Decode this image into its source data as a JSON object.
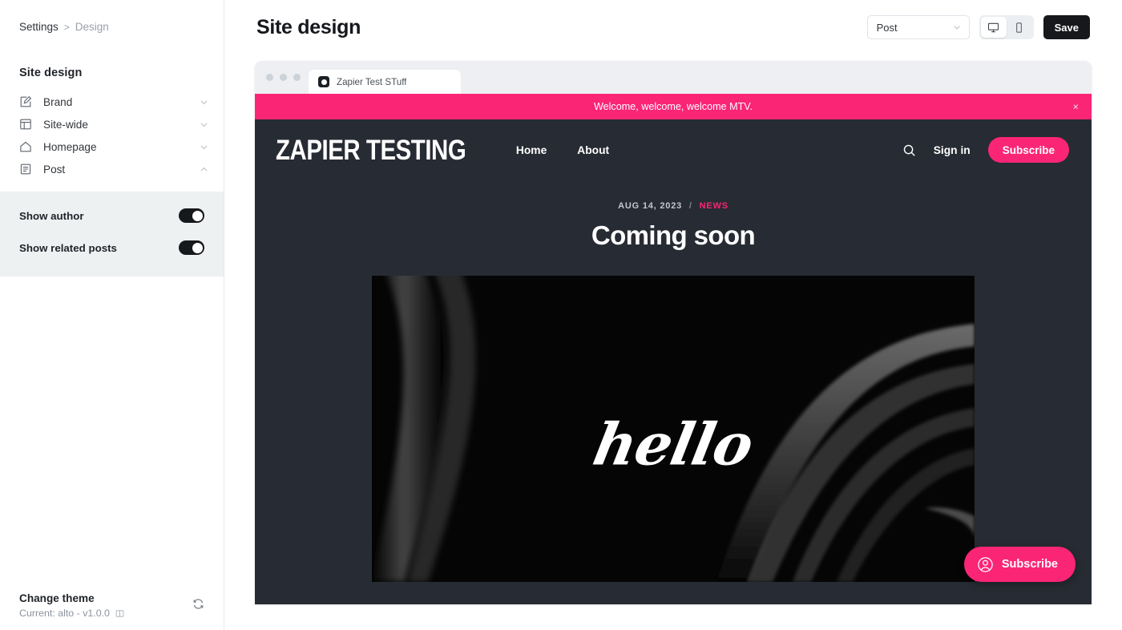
{
  "breadcrumb": {
    "root": "Settings",
    "separator": ">",
    "current": "Design"
  },
  "sidebar": {
    "title": "Site design",
    "items": [
      {
        "label": "Brand",
        "icon": "pencil-square-icon",
        "chevron": "chevron-down-icon"
      },
      {
        "label": "Site-wide",
        "icon": "layout-icon",
        "chevron": "chevron-down-icon"
      },
      {
        "label": "Homepage",
        "icon": "home-icon",
        "chevron": "chevron-down-icon"
      },
      {
        "label": "Post",
        "icon": "document-icon",
        "chevron": "chevron-up-icon"
      }
    ],
    "post_panel": {
      "toggles": [
        {
          "label": "Show author",
          "value": "on"
        },
        {
          "label": "Show related posts",
          "value": "on"
        }
      ]
    },
    "theme": {
      "title": "Change theme",
      "current": "Current: alto - v1.0.0",
      "book_icon": "book-icon",
      "refresh_icon": "refresh-icon"
    }
  },
  "header": {
    "title": "Site design",
    "page_select": {
      "value": "Post",
      "chevron": "chevron-down-icon"
    },
    "viewport": {
      "desktop": {
        "icon": "desktop-icon",
        "active": true
      },
      "mobile": {
        "icon": "mobile-icon",
        "active": false
      }
    },
    "save_label": "Save"
  },
  "preview": {
    "browser": {
      "tab_title": "Zapier Test STuff",
      "favicon": "circle-favicon",
      "dots": 3
    },
    "announcement": {
      "message": "Welcome, welcome, welcome MTV.",
      "close_icon": "×"
    },
    "site_header": {
      "logo": "ZAPIER TESTING",
      "nav": [
        "Home",
        "About"
      ],
      "search_icon": "search-icon",
      "sign_in": "Sign in",
      "subscribe": "Subscribe"
    },
    "post": {
      "date": "AUG 14, 2023",
      "separator": "/",
      "tag": "NEWS",
      "title": "Coming soon",
      "hero_word": "hello"
    },
    "floating_subscribe": {
      "label": "Subscribe",
      "icon": "user-circle-icon"
    }
  },
  "colors": {
    "accent_pink": "#fb2576",
    "site_dark": "#272b33",
    "save_black": "#16181c",
    "panel_gray": "#edf1f2"
  }
}
